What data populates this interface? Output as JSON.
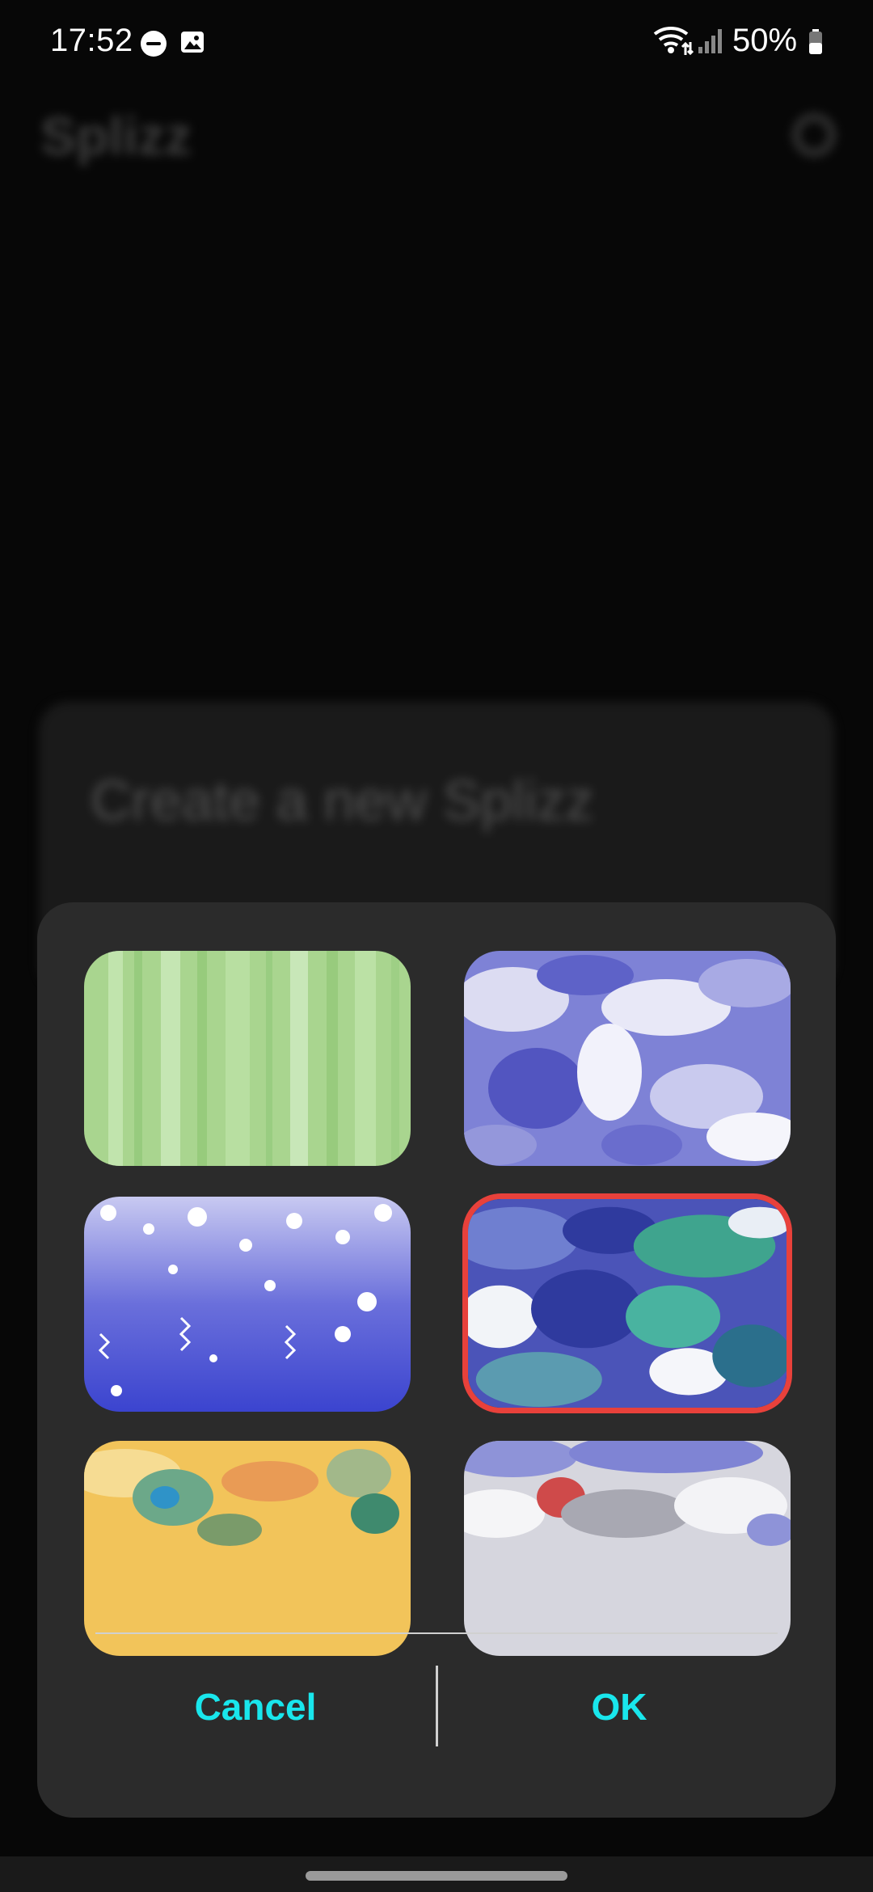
{
  "status_bar": {
    "time": "17:52",
    "battery": "50%",
    "icons": [
      "do-not-disturb-icon",
      "image-icon",
      "wifi-icon",
      "signal-icon",
      "battery-icon"
    ]
  },
  "background_app": {
    "title": "Splizz",
    "create_card_label": "Create a new Splizz",
    "settings_icon": "gear-icon"
  },
  "dialog": {
    "backgrounds": [
      {
        "name": "green-streaks",
        "selected": false
      },
      {
        "name": "blue-white-swirl",
        "selected": false
      },
      {
        "name": "blue-bubbles",
        "selected": false
      },
      {
        "name": "teal-blue-swirl",
        "selected": true
      },
      {
        "name": "yellow-green-swirl",
        "selected": false
      },
      {
        "name": "white-red-blue-swirl",
        "selected": false
      }
    ],
    "cancel_label": "Cancel",
    "ok_label": "OK"
  },
  "colors": {
    "accent": "#19e6ec",
    "selection": "#e8413b",
    "dialog_bg": "#2b2b2b"
  }
}
